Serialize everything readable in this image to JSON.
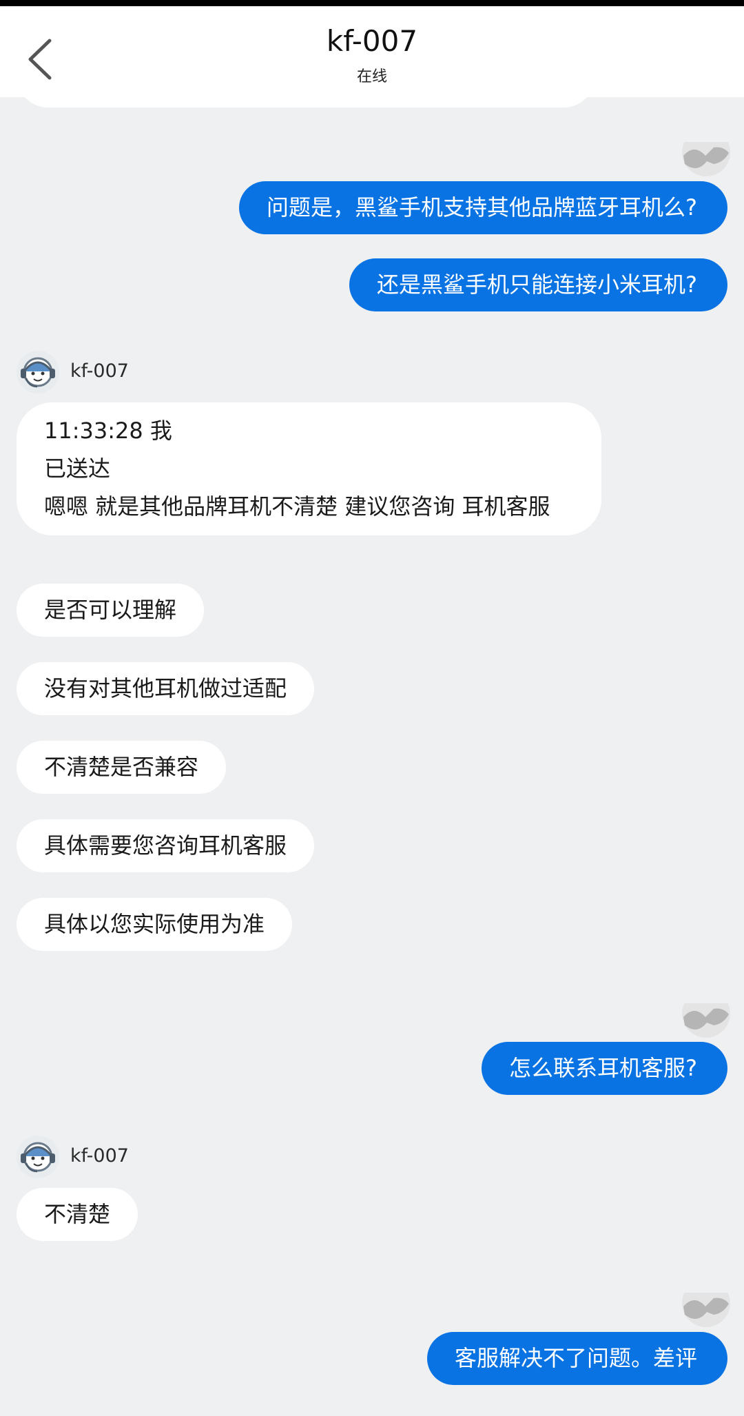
{
  "header": {
    "title": "kf-007",
    "status": "在线"
  },
  "agent": {
    "name": "kf-007"
  },
  "messages": {
    "m1": "问题是，黑鲨手机支持其他品牌蓝牙耳机么?",
    "m2": "还是黑鲨手机只能连接小米耳机?",
    "r1_line1": "11:33:28 我",
    "r1_line2": "已送达",
    "r1_line3": "嗯嗯 就是其他品牌耳机不清楚 建议您咨询 耳机客服",
    "r2": "是否可以理解",
    "r3": "没有对其他耳机做过适配",
    "r4": "不清楚是否兼容",
    "r5": "具体需要您咨询耳机客服",
    "r6": "具体以您实际使用为准",
    "m3": "怎么联系耳机客服?",
    "r7": "不清楚",
    "m4": "客服解决不了问题。差评"
  },
  "colors": {
    "accent": "#0a73e4",
    "background": "#eff0f1",
    "bubble_in": "#ffffff"
  },
  "icons": {
    "back": "chevron-left-icon",
    "my_avatar": "user-avatar-icon",
    "agent_avatar": "agent-headset-avatar-icon"
  }
}
